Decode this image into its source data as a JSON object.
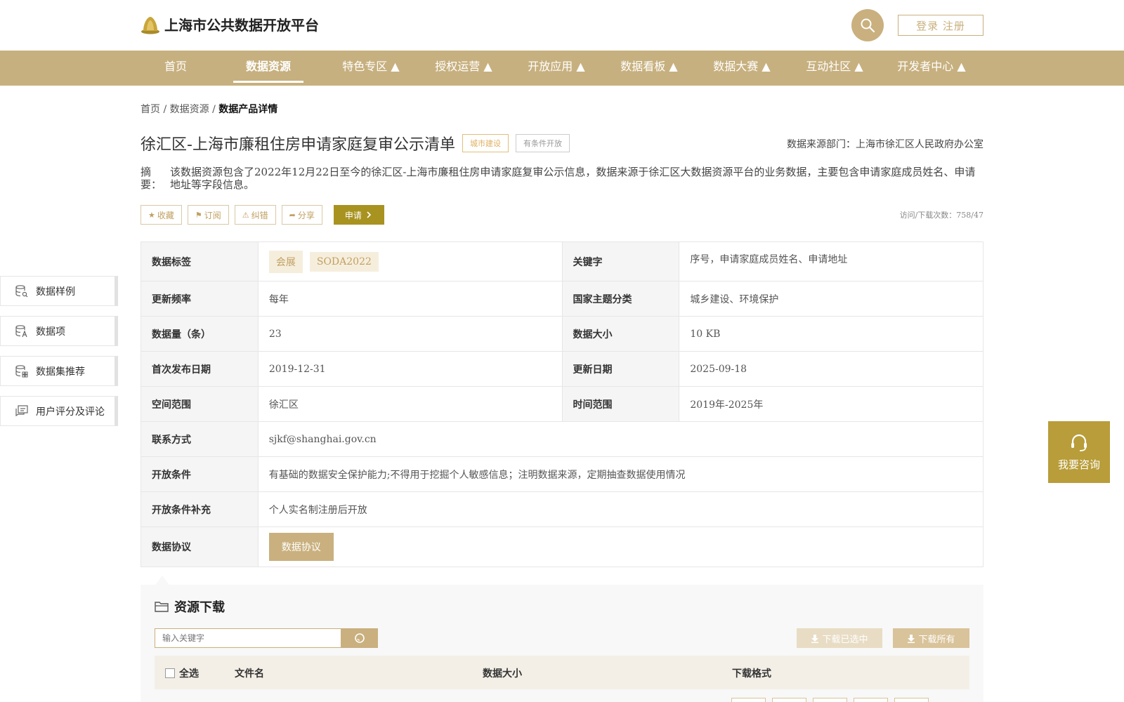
{
  "header": {
    "logo_text": "上海市公共数据开放平台",
    "login_label": "登录 注册"
  },
  "nav": {
    "items": [
      {
        "label": "首页"
      },
      {
        "label": "数据资源",
        "active": true
      },
      {
        "label": "特色专区 ▲"
      },
      {
        "label": "授权运营 ▲"
      },
      {
        "label": "开放应用 ▲"
      },
      {
        "label": "数据看板 ▲"
      },
      {
        "label": "数据大赛 ▲"
      },
      {
        "label": "互动社区 ▲"
      },
      {
        "label": "开发者中心 ▲"
      }
    ]
  },
  "breadcrumb": {
    "home": "首页",
    "sep": " / ",
    "section": "数据资源",
    "current": "数据产品详情"
  },
  "dataset": {
    "title": "徐汇区-上海市廉租住房申请家庭复审公示清单",
    "tag_category": "城市建设",
    "tag_open": "有条件开放",
    "source_dept": "数据来源部门：上海市徐汇区人民政府办公室",
    "summary_label": "摘　要：",
    "summary_text": "该数据资源包含了2022年12月22日至今的徐汇区-上海市廉租住房申请家庭复审公示信息，数据来源于徐汇区大数据资源平台的业务数据，主要包含申请家庭成员姓名、申请地址等字段信息。"
  },
  "actions": {
    "favorite": "收藏",
    "subscribe": "订阅",
    "report": "纠错",
    "share": "分享",
    "apply": "申请",
    "visit_count": "访问/下载次数：758/47"
  },
  "info": {
    "tags_label": "数据标签",
    "tags": [
      "会展",
      "SODA2022"
    ],
    "keywords_label": "关键字",
    "keywords": "序号，申请家庭成员姓名、申请地址",
    "freq_label": "更新频率",
    "freq": "每年",
    "theme_label": "国家主题分类",
    "theme": "城乡建设、环境保护",
    "count_label": "数据量（条）",
    "count": "23",
    "size_label": "数据大小",
    "size": "10 KB",
    "first_pub_label": "首次发布日期",
    "first_pub": "2019-12-31",
    "updated_label": "更新日期",
    "updated": "2025-09-18",
    "space_label": "空间范围",
    "space": "徐汇区",
    "time_label": "时间范围",
    "time": "2019年-2025年",
    "contact_label": "联系方式",
    "contact": "sjkf@shanghai.gov.cn",
    "cond_label": "开放条件",
    "cond": "有基础的数据安全保护能力;不得用于挖掘个人敏感信息；注明数据来源，定期抽查数据使用情况",
    "cond_extra_label": "开放条件补充",
    "cond_extra": "个人实名制注册后开放",
    "protocol_label": "数据协议",
    "protocol_btn": "数据协议"
  },
  "side_menu": {
    "items": [
      {
        "label": "数据样例"
      },
      {
        "label": "数据项"
      },
      {
        "label": "数据集推荐"
      },
      {
        "label": "用户评分及评论"
      }
    ]
  },
  "consult": {
    "label": "我要咨询"
  },
  "download": {
    "title": "资源下载",
    "search_placeholder": "输入关键字",
    "download_selected": "下载已选中",
    "download_all": "下载所有",
    "col_select_all": "全选",
    "col_filename": "文件名",
    "col_size": "数据大小",
    "col_format": "下载格式"
  },
  "colors": {
    "brand_gold": "#c7b07f",
    "apply_olive": "#a89320",
    "consult_gold": "#b89d3a"
  }
}
